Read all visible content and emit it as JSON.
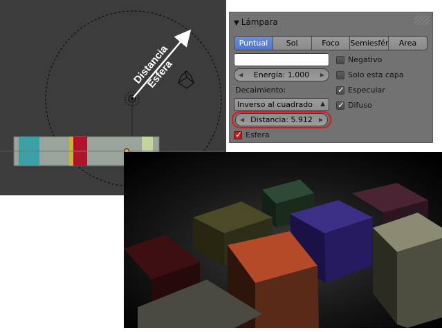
{
  "viewport": {
    "annotation": {
      "line1": "Distancia",
      "line2": "Esfera"
    },
    "strip_colors": [
      "#9aa49a",
      "#3aa0a6",
      "#9aa49a",
      "#c6b43c",
      "#b3132a",
      "#9aa49a",
      "#c3d39e"
    ]
  },
  "panel": {
    "title": "Lámpara",
    "lamp_types": [
      "Puntual",
      "Sol",
      "Foco",
      "Semiesféric",
      "Area"
    ],
    "selected_type": "Puntual",
    "color_value": "#ffffff",
    "energy_label": "Energía: 1.000",
    "falloff_label": "Decaimiento:",
    "falloff_value": "Inverso al cuadrado",
    "distance_label": "Distancia: 5.912",
    "checkboxes": {
      "negativo": {
        "label": "Negativo",
        "checked": false
      },
      "solo_esta_capa": {
        "label": "Solo esta capa",
        "checked": false
      },
      "especular": {
        "label": "Especular",
        "checked": true
      },
      "difuso": {
        "label": "Difuso",
        "checked": true
      },
      "esfera": {
        "label": "Esfera",
        "checked": true
      }
    },
    "colors": {
      "active_tab": "#5a7fd0",
      "highlight": "#e0141e"
    }
  }
}
